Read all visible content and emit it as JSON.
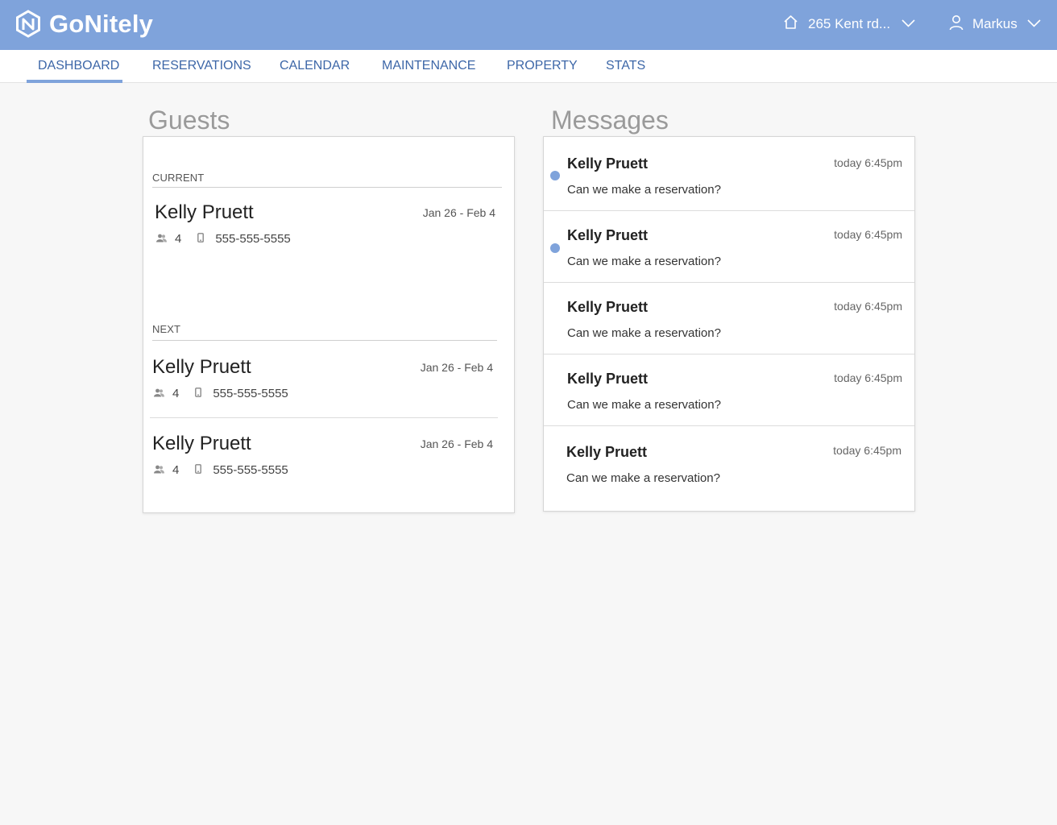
{
  "header": {
    "brand": "GoNitely",
    "property_label": "265 Kent rd...",
    "user_label": "Markus"
  },
  "nav": {
    "tabs": [
      {
        "label": "DASHBOARD",
        "active": true
      },
      {
        "label": "RESERVATIONS",
        "active": false
      },
      {
        "label": "CALENDAR",
        "active": false
      },
      {
        "label": "MAINTENANCE",
        "active": false
      },
      {
        "label": "PROPERTY",
        "active": false
      },
      {
        "label": "STATS",
        "active": false
      }
    ]
  },
  "guests": {
    "title": "Guests",
    "current_label": "CURRENT",
    "next_label": "NEXT",
    "current": [
      {
        "name": "Kelly Pruett",
        "dates": "Jan 26 - Feb 4",
        "count": "4",
        "phone": "555-555-5555"
      }
    ],
    "next": [
      {
        "name": "Kelly Pruett",
        "dates": "Jan 26 - Feb 4",
        "count": "4",
        "phone": "555-555-5555"
      },
      {
        "name": "Kelly Pruett",
        "dates": "Jan 26 - Feb 4",
        "count": "4",
        "phone": "555-555-5555"
      }
    ]
  },
  "messages": {
    "title": "Messages",
    "items": [
      {
        "name": "Kelly Pruett",
        "time": "today 6:45pm",
        "text": "Can we make a reservation?",
        "unread": true
      },
      {
        "name": "Kelly Pruett",
        "time": "today 6:45pm",
        "text": "Can we make a reservation?",
        "unread": true
      },
      {
        "name": "Kelly Pruett",
        "time": "today 6:45pm",
        "text": "Can we make a reservation?",
        "unread": false
      },
      {
        "name": "Kelly Pruett",
        "time": "today 6:45pm",
        "text": "Can we make a reservation?",
        "unread": false
      },
      {
        "name": "Kelly Pruett",
        "time": "today 6:45pm",
        "text": "Can we make a reservation?",
        "unread": false
      }
    ]
  },
  "colors": {
    "header_bg": "#7fa3db",
    "accent": "#3d67a8",
    "unread_dot": "#7fa3db"
  },
  "icons": {
    "logo": "gonitely-logo-icon",
    "property": "home-icon",
    "user": "user-icon",
    "dropdown": "chevron-down-icon",
    "guests": "people-icon",
    "phone": "phone-icon"
  }
}
